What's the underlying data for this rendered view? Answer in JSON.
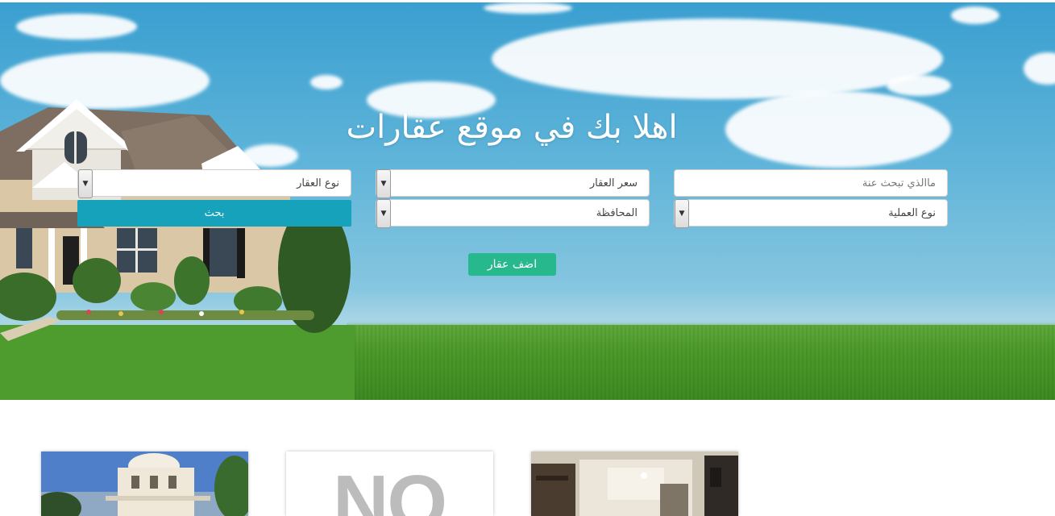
{
  "hero": {
    "welcome_title": "اهلا بك في موقع عقارات",
    "search": {
      "query_placeholder": "ماالذي تبحث عنة",
      "operation_type": "نوع العملية",
      "property_price": "سعر العقار",
      "governorate": "المحافظة",
      "property_type": "نوع العقار",
      "search_button": "بحث"
    },
    "add_property_button": "اضف عقار"
  },
  "listings": [
    {
      "image": "villa-photo"
    },
    {
      "image": "no-image-placeholder",
      "placeholder_text": "NO"
    },
    {
      "image": "interior-photo"
    }
  ],
  "colors": {
    "search_button": "#17a2bb",
    "add_button": "#27b98d"
  }
}
